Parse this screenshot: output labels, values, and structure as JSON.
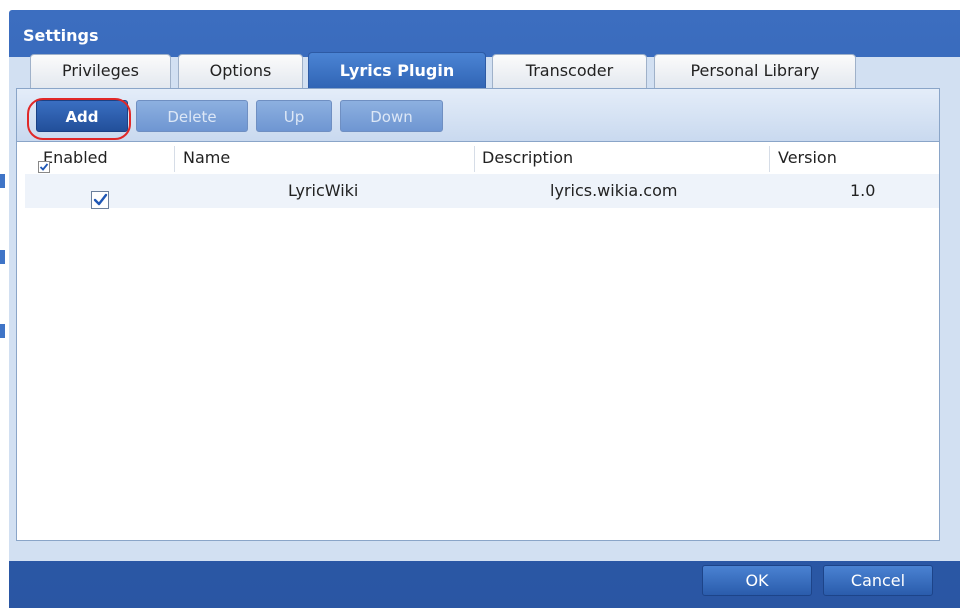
{
  "dialog": {
    "title": "Settings"
  },
  "tabs": [
    {
      "label": "Privileges",
      "active": false
    },
    {
      "label": "Options",
      "active": false
    },
    {
      "label": "Lyrics Plugin",
      "active": true
    },
    {
      "label": "Transcoder",
      "active": false
    },
    {
      "label": "Personal Library",
      "active": false
    }
  ],
  "toolbar": {
    "add_label": "Add",
    "delete_label": "Delete",
    "up_label": "Up",
    "down_label": "Down"
  },
  "grid": {
    "columns": [
      "Enabled",
      "Name",
      "Description",
      "Version"
    ],
    "header_enabled_checked": true,
    "rows": [
      {
        "enabled": true,
        "name": "LyricWiki",
        "description": "lyrics.wikia.com",
        "version": "1.0"
      }
    ]
  },
  "footer": {
    "ok_label": "OK",
    "cancel_label": "Cancel"
  },
  "colors": {
    "accent": "#2d5cac",
    "highlight": "#e02828"
  }
}
